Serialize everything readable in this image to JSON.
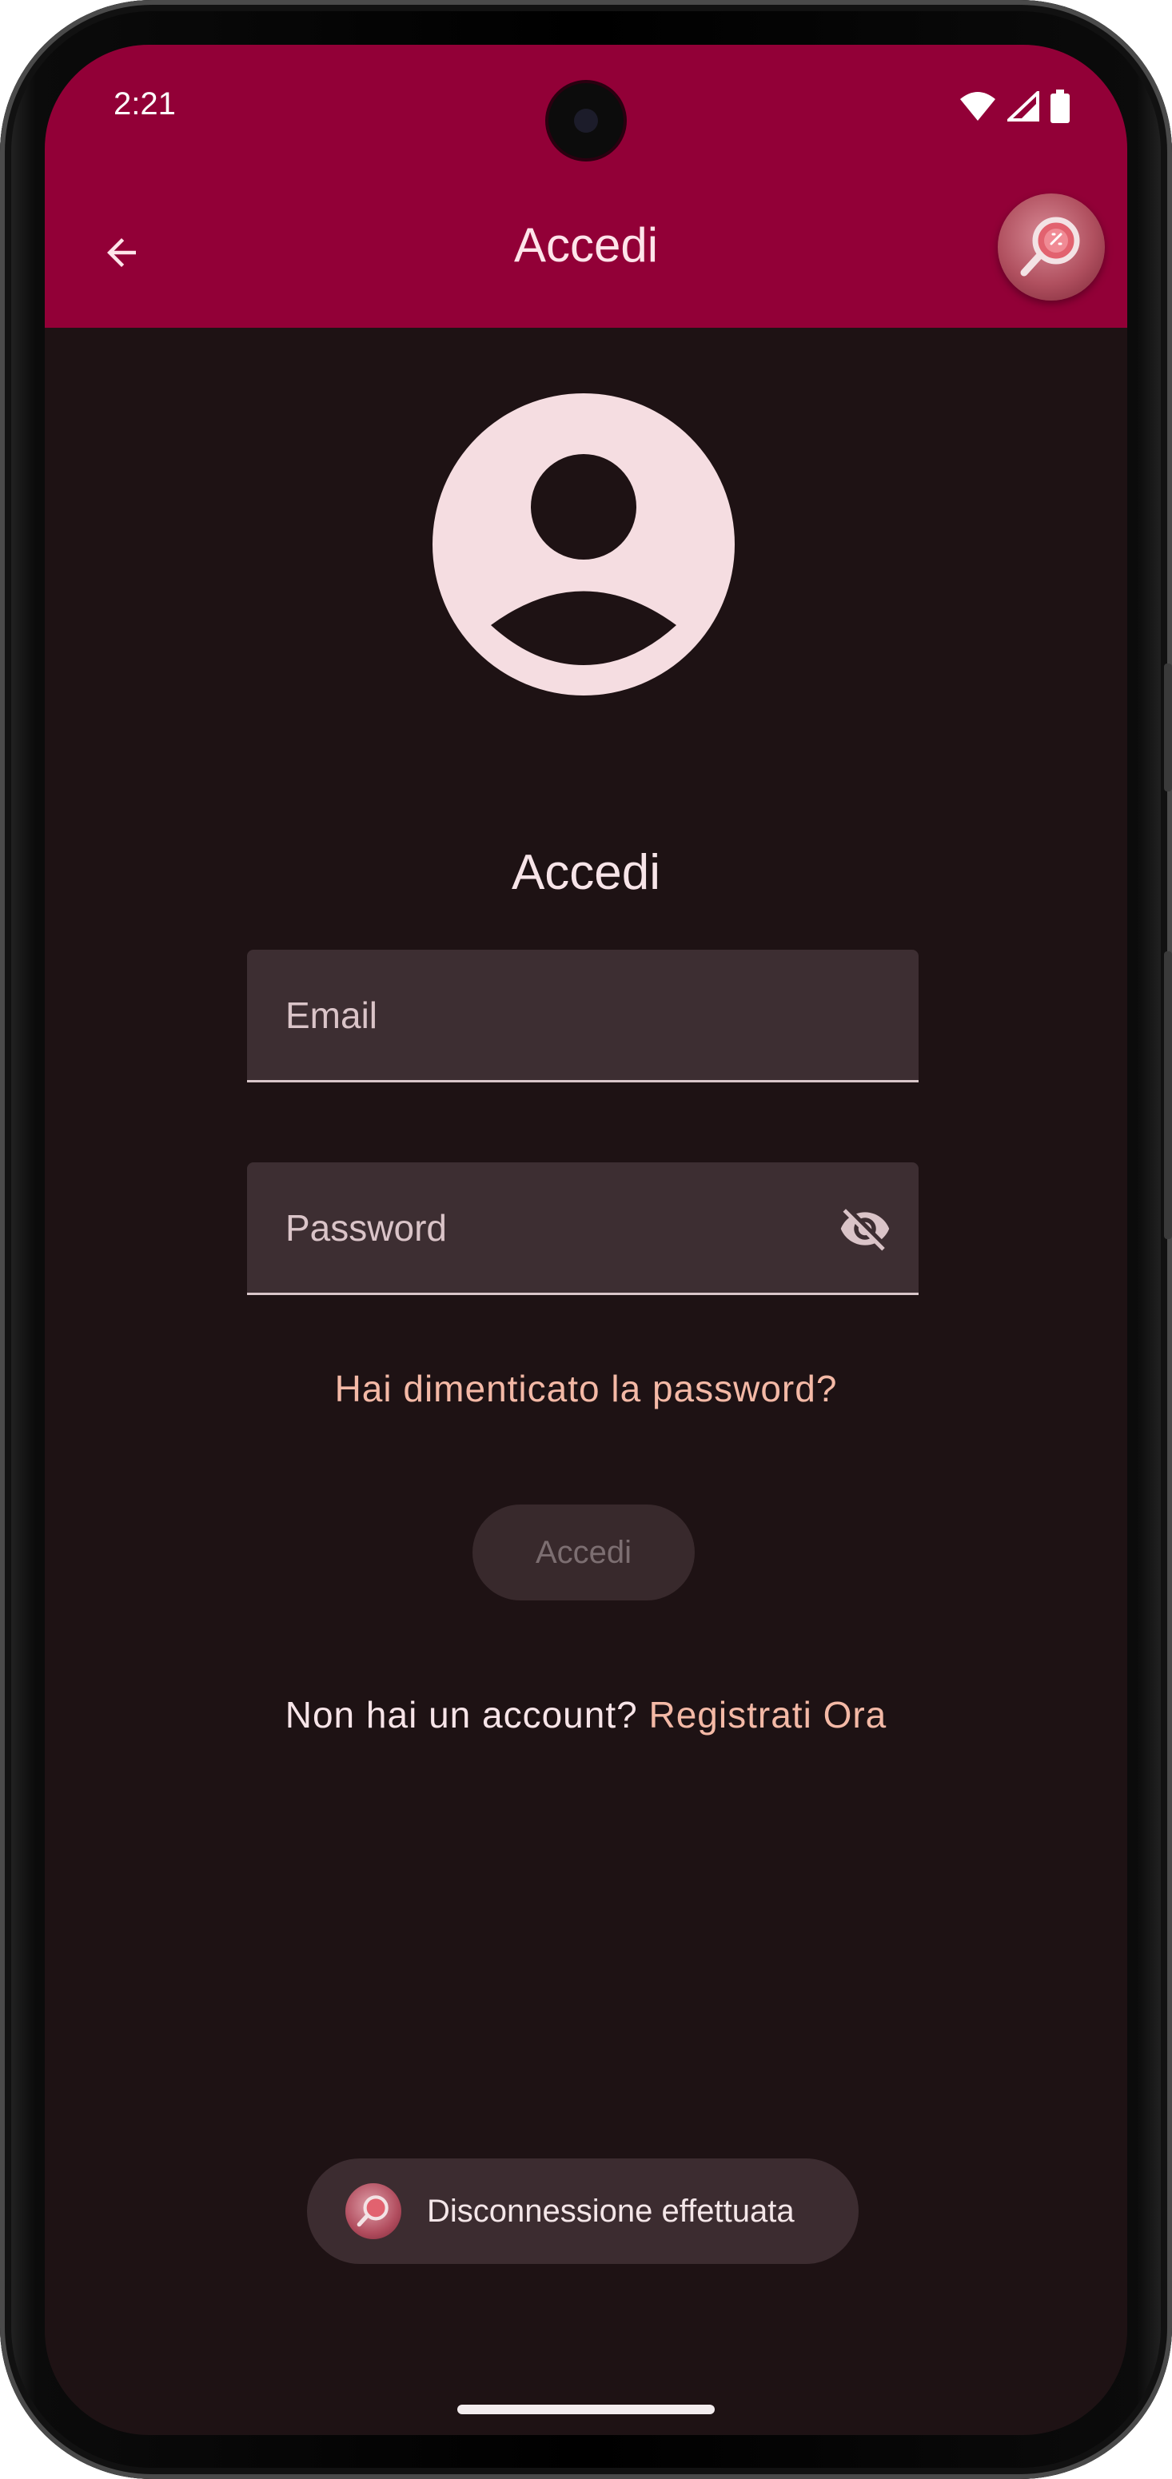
{
  "status_bar": {
    "time": "2:21"
  },
  "app_bar": {
    "title": "Accedi",
    "back_icon": "arrow-left-icon",
    "logo_icon": "magnifier-logo-icon"
  },
  "login_form": {
    "avatar_icon": "account-circle-icon",
    "heading": "Accedi",
    "email_placeholder": "Email",
    "password_placeholder": "Password",
    "password_toggle_icon": "eye-off-icon",
    "forgot_password": "Hai dimenticato la password?",
    "submit_label": "Accedi",
    "no_account_text": "Non hai un account?",
    "register_link": "Registrati Ora"
  },
  "snackbar": {
    "message": "Disconnessione effettuata",
    "icon": "magnifier-logo-icon"
  },
  "colors": {
    "app_bar": "#920037",
    "background": "#1e1214",
    "accent": "#f4b9a6",
    "field_bg": "#3d2e32"
  }
}
